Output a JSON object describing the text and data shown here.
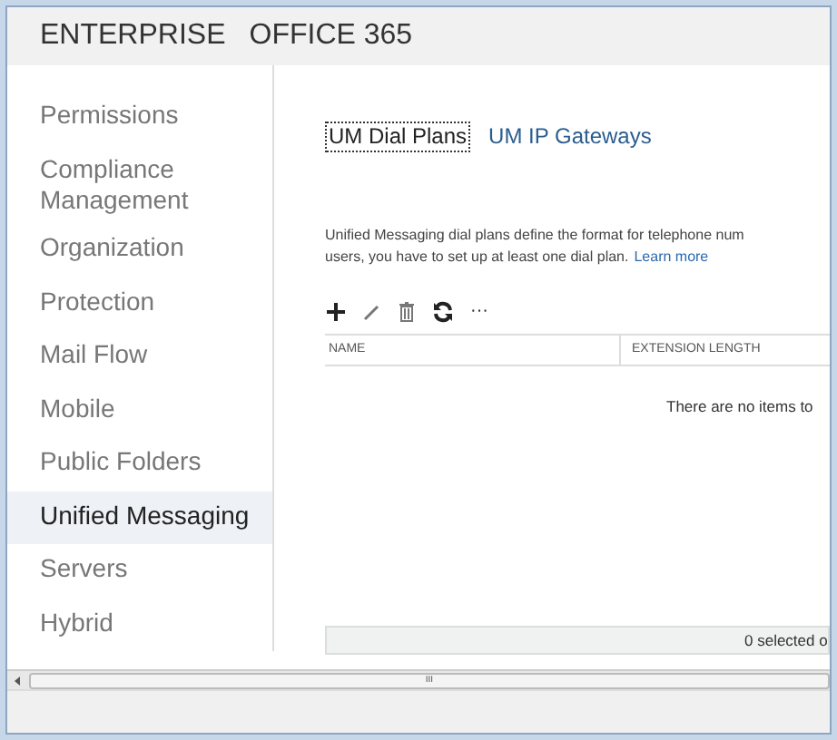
{
  "header": {
    "title": "ENTERPRISE",
    "product": "OFFICE 365"
  },
  "sidebar": {
    "items": [
      {
        "label": "Permissions",
        "selected": false
      },
      {
        "label": "Compliance Management",
        "selected": false
      },
      {
        "label": "Organization",
        "selected": false
      },
      {
        "label": "Protection",
        "selected": false
      },
      {
        "label": "Mail Flow",
        "selected": false
      },
      {
        "label": "Mobile",
        "selected": false
      },
      {
        "label": "Public Folders",
        "selected": false
      },
      {
        "label": "Unified Messaging",
        "selected": true
      },
      {
        "label": "Servers",
        "selected": false
      },
      {
        "label": "Hybrid",
        "selected": false
      }
    ]
  },
  "tabs": [
    {
      "label": "UM Dial Plans",
      "selected": true
    },
    {
      "label": "UM IP Gateways",
      "selected": false
    }
  ],
  "description": {
    "line_1": "Unified Messaging dial plans define the format for telephone num",
    "line_2": "users, you have to set up at least one dial plan.",
    "link": "Learn more"
  },
  "toolbar": [
    {
      "kind": "add"
    },
    {
      "kind": "edit"
    },
    {
      "kind": "delete"
    },
    {
      "kind": "refresh"
    },
    {
      "kind": "more",
      "label": "···"
    }
  ],
  "table": {
    "columns": [
      "NAME",
      "EXTENSION LENGTH"
    ],
    "empty_message": "There are no items to"
  },
  "footer": {
    "status": "0 selected o"
  },
  "scrollbar": {
    "thumb_label": "III"
  }
}
